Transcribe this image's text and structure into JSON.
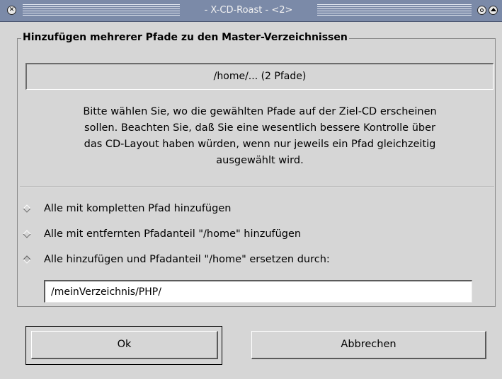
{
  "window": {
    "title": "- X-CD-Roast - <2> ",
    "close_glyph": "✕"
  },
  "frame": {
    "title": "Hinzufügen mehrerer Pfade zu den Master-Verzeichnissen",
    "path_summary": "/home/... (2 Pfade)",
    "description": [
      "Bitte wählen Sie, wo die gewählten Pfade auf der Ziel-CD erscheinen",
      "sollen. Beachten Sie, daß Sie eine wesentlich bessere Kontrolle über",
      "das CD-Layout haben würden, wenn nur jeweils ein Pfad gleichzeitig",
      "ausgewählt wird."
    ]
  },
  "options": [
    {
      "label": "Alle mit kompletten Pfad hinzufügen",
      "selected": false
    },
    {
      "label": "Alle mit entfernten Pfadanteil \"/home\" hinzufügen",
      "selected": false
    },
    {
      "label": "Alle hinzufügen und Pfadanteil \"/home\" ersetzen durch:",
      "selected": true
    }
  ],
  "replacement_input": {
    "value": "/meinVerzeichnis/PHP/"
  },
  "buttons": {
    "ok": "Ok",
    "cancel": "Abbrechen"
  }
}
